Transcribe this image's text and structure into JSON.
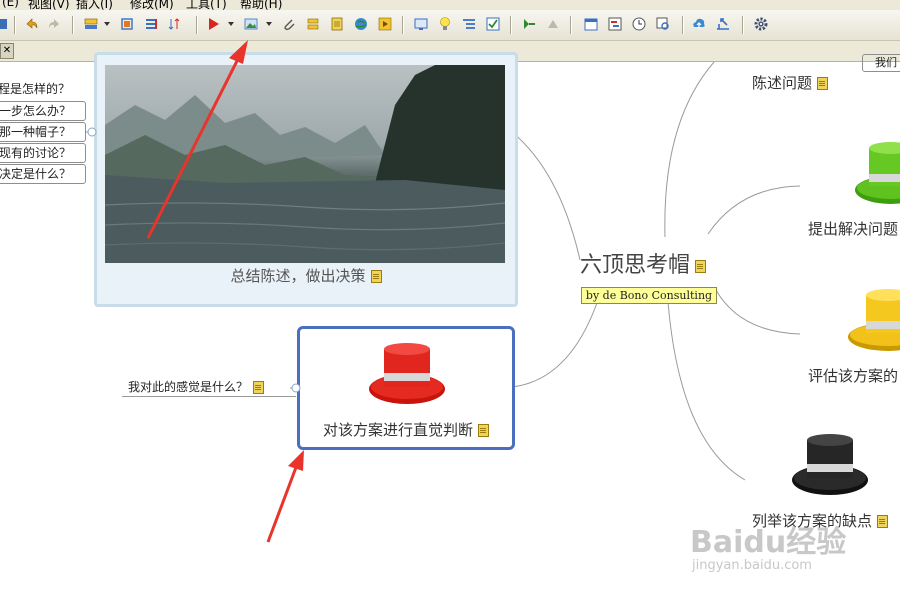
{
  "menubar": {
    "items": [
      "(E)",
      "视图(V)",
      "插入(I)",
      "修改(M)",
      "工具(T)",
      "帮助(H)"
    ]
  },
  "toolbar": {
    "icons": [
      "undo-icon",
      "redo-icon",
      "topic-icon",
      "subtopic-icon",
      "boundary-icon",
      "sort-icon",
      "flag-icon",
      "image-icon",
      "attach-icon",
      "relationship-icon",
      "note-icon",
      "hyperlink-icon",
      "audio-icon",
      "presentation-icon",
      "idea-icon",
      "outline-icon",
      "task-icon",
      "export-icon",
      "share-icon",
      "calendar-icon",
      "gantt-icon",
      "clock-icon",
      "zoom-icon",
      "upload-icon",
      "publish-icon",
      "settings-icon"
    ]
  },
  "tab": {
    "close_label": "✕"
  },
  "mindmap": {
    "central": {
      "title": "六顶思考帽",
      "label": "by de Bono Consulting"
    },
    "blue_hat": {
      "caption": "总结陈述，做出决策",
      "questions": [
        "程是怎样的？",
        "一步怎么办？",
        "那一种帽子？",
        "现有的讨论？",
        "决定是什么？"
      ]
    },
    "red_hat": {
      "caption": "对该方案进行直觉判断",
      "sub": "我对此的感觉是什么？"
    },
    "white_hat": {
      "caption": "陈述问题",
      "partial": "我们"
    },
    "green_hat": {
      "caption": "提出解决问题"
    },
    "yellow_hat": {
      "caption": "评估该方案的"
    },
    "black_hat": {
      "caption": "列举该方案的缺点"
    }
  },
  "watermark": {
    "brand": "Baidu经验",
    "url": "jingyan.baidu.com"
  },
  "colors": {
    "accent_arrow": "#e8342a",
    "selected_border": "#4a6fbe",
    "image_border": "#c9dcea",
    "toolbar_bg": "#ece9d8"
  }
}
